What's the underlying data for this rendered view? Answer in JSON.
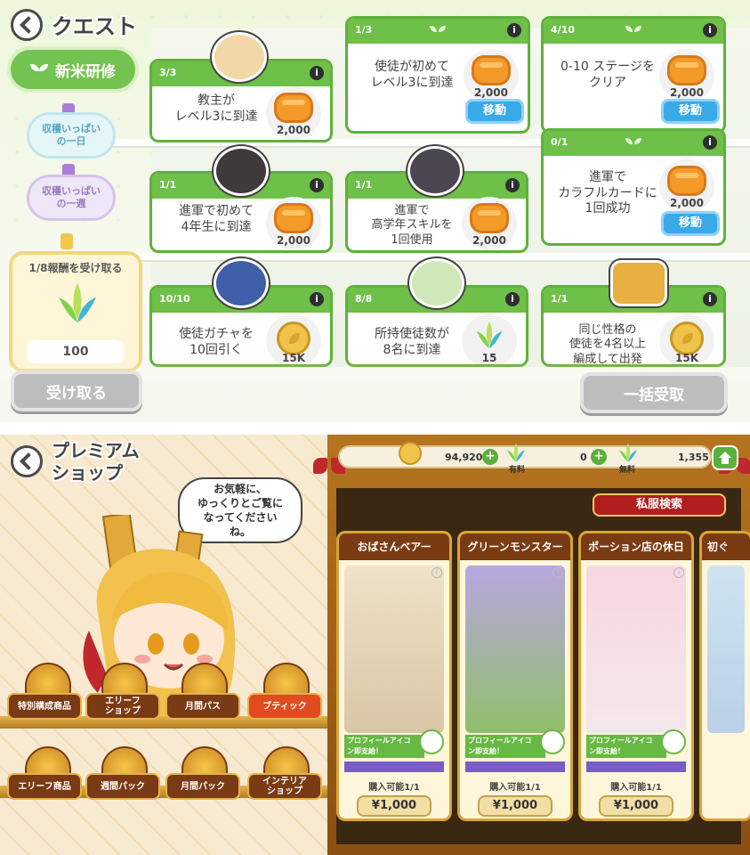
{
  "quest": {
    "title": "クエスト",
    "category_main": "新米研修",
    "chips": [
      "収穫いっぱい\nの一日",
      "収穫いっぱい\nの一週"
    ],
    "reward_label": "1/8報酬を受け取る",
    "reward_amount": "100",
    "receive_button": "受け取る",
    "bulk_receive_button": "一括受取",
    "go_label": "移動",
    "cards": [
      {
        "progress": "3/3",
        "text": "教主が\nレベル3に到達",
        "amount": "2,000"
      },
      {
        "progress": "1/3",
        "text": "使徒が初めて\nレベル3に到達",
        "amount": "2,000"
      },
      {
        "progress": "4/10",
        "text": "0-10 ステージを\nクリア",
        "amount": "2,000"
      },
      {
        "progress": "1/1",
        "text": "進軍で初めて\n4年生に到達",
        "amount": "2,000"
      },
      {
        "progress": "1/1",
        "text": "進軍で\n高学年スキルを\n1回使用",
        "amount": "2,000"
      },
      {
        "progress": "0/1",
        "text": "進軍で\nカラフルカードに\n1回成功",
        "amount": "2,000"
      },
      {
        "progress": "10/10",
        "text": "使徒ガチャを\n10回引く",
        "amount": "15K"
      },
      {
        "progress": "8/8",
        "text": "所持使徒数が\n8名に到達",
        "amount": "15"
      },
      {
        "progress": "1/1",
        "text": "同じ性格の\n使徒を4名以上\n編成して出発",
        "amount": "15K"
      }
    ]
  },
  "shop": {
    "title": "プレミアム\nショップ",
    "bubble": "お気軽に、\nゆっくりとご覧に\nなってください\nね。",
    "currency_gold": "94,920",
    "currency_paid": "0",
    "currency_paid_label": "有料",
    "currency_free": "1,355",
    "currency_free_label": "無料",
    "search_tab": "私服検索",
    "buttons": [
      "特別構成商品",
      "エリーフ\nショップ",
      "月間パス",
      "ブティック",
      "エリーフ商品",
      "週間パック",
      "月間パック",
      "インテリア\nショップ"
    ],
    "products": [
      {
        "title": "おばさんベアー",
        "tag": "プロフィールアイコ\nン即支給！",
        "limit": "購入可能1/1",
        "price": "¥1,000"
      },
      {
        "title": "グリーンモンスター",
        "tag": "プロフィールアイコ\nン即支給！",
        "limit": "購入可能1/1",
        "price": "¥1,000"
      },
      {
        "title": "ポーション店の休日",
        "tag": "プロフィールアイコ\nン即支給！",
        "limit": "購入可能1/1",
        "price": "¥1,000"
      },
      {
        "title": "初ぐ"
      }
    ]
  }
}
